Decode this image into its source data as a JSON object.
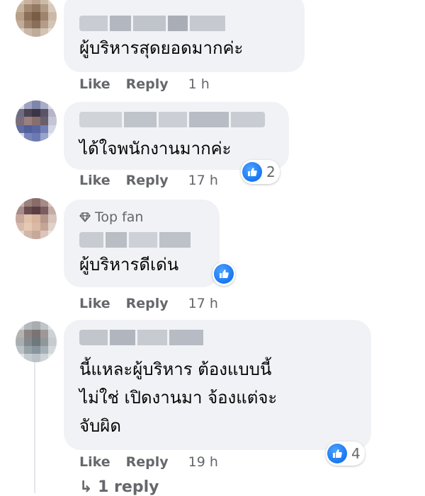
{
  "colors": {
    "bubble_bg": "#f0f2f5",
    "meta_text": "#65676b",
    "like_blue": "#1877f2"
  },
  "comments": [
    {
      "author_blurred": true,
      "text": "ผู้บริหารสุดยอดมากค่ะ",
      "like_label": "Like",
      "reply_label": "Reply",
      "time": "1 h"
    },
    {
      "author_blurred": true,
      "text": "ได้ใจพนักงานมากค่ะ",
      "like_label": "Like",
      "reply_label": "Reply",
      "time": "17 h",
      "reactions": {
        "icon": "like-icon",
        "count": "2"
      }
    },
    {
      "author_blurred": true,
      "badge": {
        "icon": "diamond-icon",
        "label": "Top fan"
      },
      "text": "ผู้บริหารดีเด่น",
      "like_label": "Like",
      "reply_label": "Reply",
      "time": "17 h",
      "reactions": {
        "icon": "like-icon"
      }
    },
    {
      "author_blurred": true,
      "text": "นี้แหละผู้บริหาร ต้องแบบนี้\nไม่ใช่ เปิดงานมา จ้องแต่จะ\nจับผิด",
      "like_label": "Like",
      "reply_label": "Reply",
      "time": "19 h",
      "reactions": {
        "icon": "like-icon",
        "count": "4"
      },
      "replies_link": "↳ 1 reply"
    }
  ]
}
